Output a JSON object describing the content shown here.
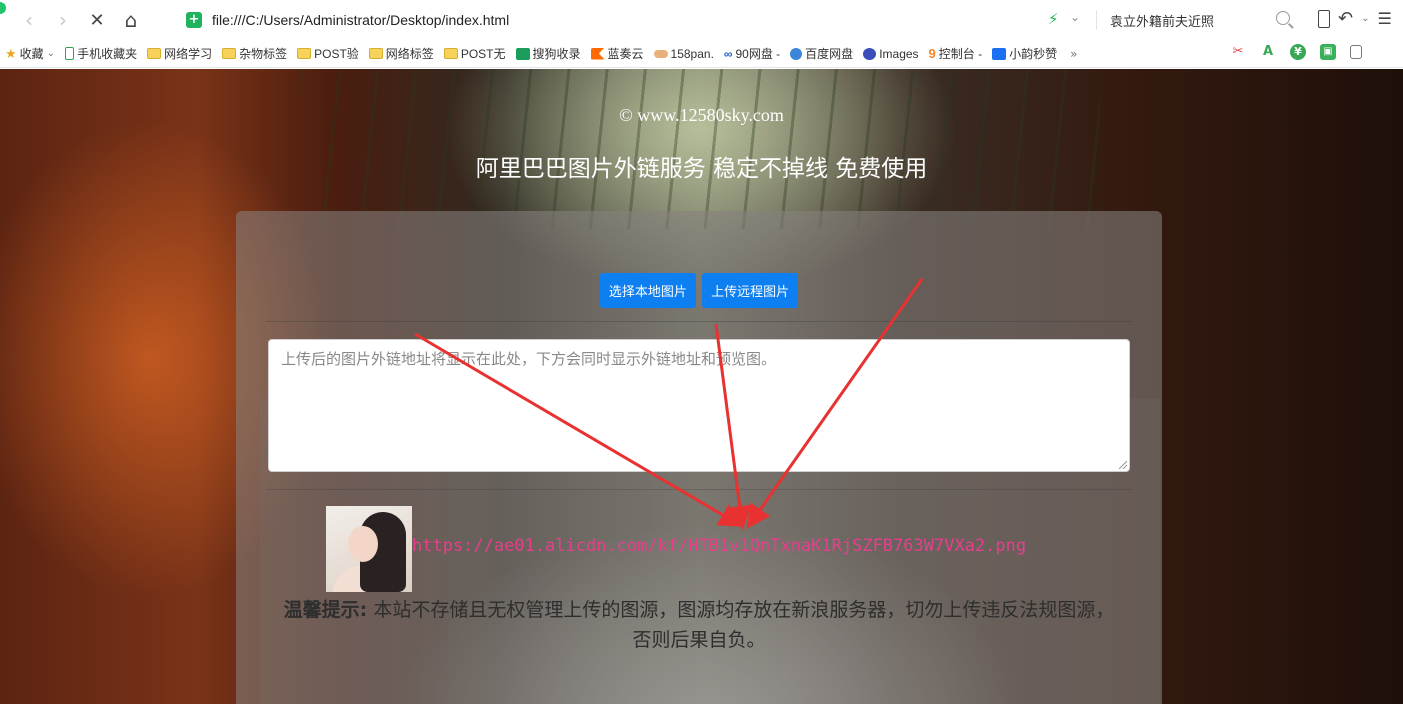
{
  "browser": {
    "url": "file:///C:/Users/Administrator/Desktop/index.html",
    "search_text": "袁立外籍前夫近照"
  },
  "bookmarks": [
    {
      "label": "收藏",
      "icon": "star-icon",
      "kind": "star",
      "chevron": true
    },
    {
      "label": "手机收藏夹",
      "icon": "phone-icon",
      "kind": "phone"
    },
    {
      "label": "网络学习",
      "icon": "folder-icon",
      "kind": "folder"
    },
    {
      "label": "杂物标签",
      "icon": "folder-icon",
      "kind": "folder"
    },
    {
      "label": "POST验",
      "icon": "folder-icon",
      "kind": "folder"
    },
    {
      "label": "网络标签",
      "icon": "folder-icon",
      "kind": "folder"
    },
    {
      "label": "POST无",
      "icon": "folder-icon",
      "kind": "folder"
    },
    {
      "label": "搜狗收录",
      "icon": "sogou-icon",
      "kind": "grid"
    },
    {
      "label": "蓝奏云",
      "icon": "lanzou-icon",
      "kind": "flag"
    },
    {
      "label": "158pan.",
      "icon": "cloud-icon",
      "kind": "cloud"
    },
    {
      "label": "90网盘 -",
      "icon": "loop-icon",
      "kind": "loop"
    },
    {
      "label": "百度网盘",
      "icon": "baidu-icon",
      "kind": "baidu"
    },
    {
      "label": "Images",
      "icon": "images-icon",
      "kind": "img"
    },
    {
      "label": "控制台 -",
      "icon": "nine-icon",
      "kind": "nine"
    },
    {
      "label": "小韵秒赞",
      "icon": "blue-square-icon",
      "kind": "blue"
    }
  ],
  "page": {
    "copyright": "© www.12580sky.com",
    "headline": "阿里巴巴图片外链服务 稳定不掉线 免费使用",
    "btn_local": "选择本地图片",
    "btn_remote": "上传远程图片",
    "textarea_placeholder": "上传后的图片外链地址将显示在此处，下方会同时显示外链地址和预览图。",
    "result_link": "https://ae01.alicdn.com/kf/HTB1v1QnTxnaK1RjSZFB763W7VXa2.png",
    "notice_bold": "温馨提示:",
    "notice_text": " 本站不存储且无权管理上传的图源，图源均存放在新浪服务器，切勿上传违反法规图源，否则后果自负。"
  },
  "colors": {
    "button": "#0d7ff0",
    "link": "#e83e8c",
    "arrow": "#e83232"
  }
}
